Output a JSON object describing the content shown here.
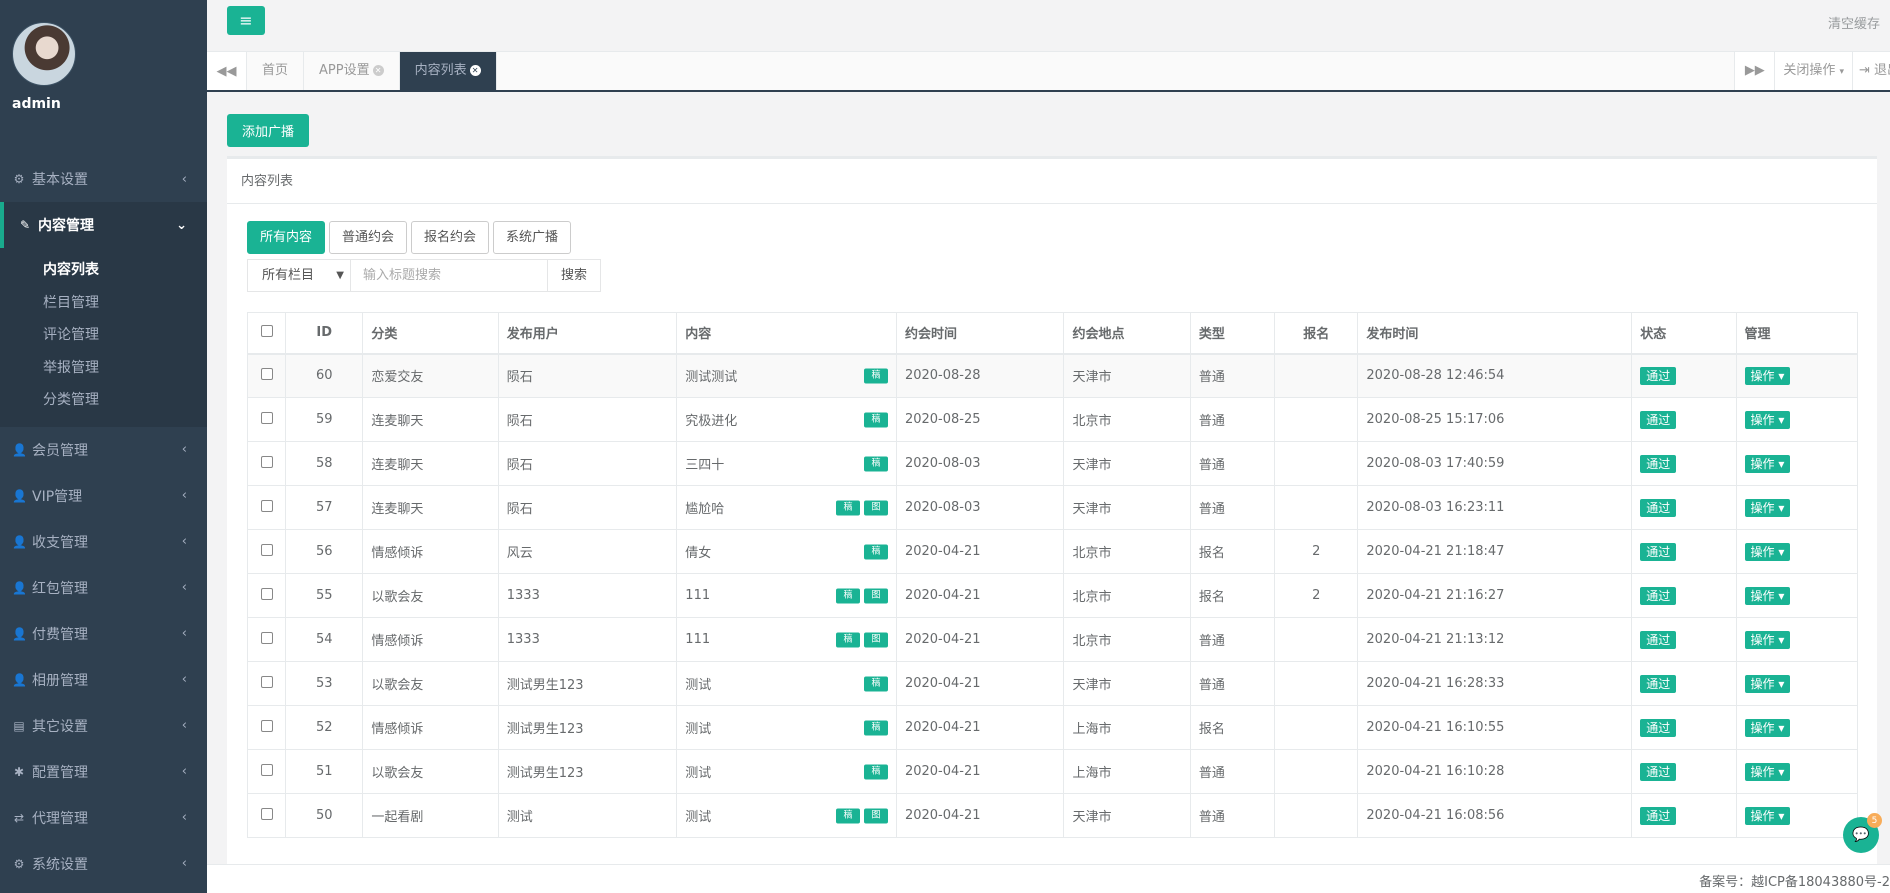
{
  "user": {
    "name": "admin"
  },
  "sidebar": {
    "items": [
      {
        "label": "基本设置",
        "icon": "gear-icon",
        "glyph": "⚙"
      },
      {
        "label": "内容管理",
        "icon": "edit-icon",
        "glyph": "✎",
        "active": true,
        "children": [
          "内容列表",
          "栏目管理",
          "评论管理",
          "举报管理",
          "分类管理"
        ]
      },
      {
        "label": "会员管理",
        "icon": "user-icon",
        "glyph": "👤"
      },
      {
        "label": "VIP管理",
        "icon": "user-icon",
        "glyph": "👤"
      },
      {
        "label": "收支管理",
        "icon": "user-icon",
        "glyph": "👤"
      },
      {
        "label": "红包管理",
        "icon": "user-icon",
        "glyph": "👤"
      },
      {
        "label": "付费管理",
        "icon": "user-icon",
        "glyph": "👤"
      },
      {
        "label": "相册管理",
        "icon": "user-icon",
        "glyph": "👤"
      },
      {
        "label": "其它设置",
        "icon": "book-icon",
        "glyph": "▤"
      },
      {
        "label": "配置管理",
        "icon": "asterisk-icon",
        "glyph": "✱"
      },
      {
        "label": "代理管理",
        "icon": "exchange-icon",
        "glyph": "⇄"
      },
      {
        "label": "系统设置",
        "icon": "gears-icon",
        "glyph": "⚙"
      }
    ]
  },
  "topbar": {
    "clear_cache": "清空缓存"
  },
  "tabs": {
    "items": [
      {
        "label": "首页",
        "closable": false
      },
      {
        "label": "APP设置",
        "closable": true
      },
      {
        "label": "内容列表",
        "closable": true,
        "active": true
      }
    ],
    "close_ops": "关闭操作",
    "logout": "退出"
  },
  "main": {
    "add_button": "添加广播",
    "panel_title": "内容列表",
    "filters": [
      "所有内容",
      "普通约会",
      "报名约会",
      "系统广播"
    ],
    "search": {
      "select_value": "所有栏目",
      "placeholder": "输入标题搜索",
      "button": "搜索"
    },
    "table": {
      "columns": [
        "ID",
        "分类",
        "发布用户",
        "内容",
        "约会时间",
        "约会地点",
        "类型",
        "报名",
        "发布时间",
        "状态",
        "管理"
      ],
      "rows": [
        {
          "id": "60",
          "cat": "恋爱交友",
          "user": "陨石",
          "content": "测试测试",
          "badges": [
            "稿"
          ],
          "date": "2020-08-28",
          "place": "天津市",
          "type": "普通",
          "signup": "",
          "time": "2020-08-28 12:46:54",
          "status": "通过",
          "op": "操作"
        },
        {
          "id": "59",
          "cat": "连麦聊天",
          "user": "陨石",
          "content": "究极进化",
          "badges": [
            "稿"
          ],
          "date": "2020-08-25",
          "place": "北京市",
          "type": "普通",
          "signup": "",
          "time": "2020-08-25 15:17:06",
          "status": "通过",
          "op": "操作"
        },
        {
          "id": "58",
          "cat": "连麦聊天",
          "user": "陨石",
          "content": "三四十",
          "badges": [
            "稿"
          ],
          "date": "2020-08-03",
          "place": "天津市",
          "type": "普通",
          "signup": "",
          "time": "2020-08-03 17:40:59",
          "status": "通过",
          "op": "操作"
        },
        {
          "id": "57",
          "cat": "连麦聊天",
          "user": "陨石",
          "content": "尴尬哈",
          "badges": [
            "稿",
            "图"
          ],
          "date": "2020-08-03",
          "place": "天津市",
          "type": "普通",
          "signup": "",
          "time": "2020-08-03 16:23:11",
          "status": "通过",
          "op": "操作"
        },
        {
          "id": "56",
          "cat": "情感倾诉",
          "user": "风云",
          "content": "倩女",
          "badges": [
            "稿"
          ],
          "date": "2020-04-21",
          "place": "北京市",
          "type": "报名",
          "signup": "2",
          "time": "2020-04-21 21:18:47",
          "status": "通过",
          "op": "操作"
        },
        {
          "id": "55",
          "cat": "以歌会友",
          "user": "1333",
          "content": "111",
          "badges": [
            "稿",
            "图"
          ],
          "date": "2020-04-21",
          "place": "北京市",
          "type": "报名",
          "signup": "2",
          "time": "2020-04-21 21:16:27",
          "status": "通过",
          "op": "操作"
        },
        {
          "id": "54",
          "cat": "情感倾诉",
          "user": "1333",
          "content": "111",
          "badges": [
            "稿",
            "图"
          ],
          "date": "2020-04-21",
          "place": "北京市",
          "type": "普通",
          "signup": "",
          "time": "2020-04-21 21:13:12",
          "status": "通过",
          "op": "操作"
        },
        {
          "id": "53",
          "cat": "以歌会友",
          "user": "测试男生123",
          "content": "测试",
          "badges": [
            "稿"
          ],
          "date": "2020-04-21",
          "place": "天津市",
          "type": "普通",
          "signup": "",
          "time": "2020-04-21 16:28:33",
          "status": "通过",
          "op": "操作"
        },
        {
          "id": "52",
          "cat": "情感倾诉",
          "user": "测试男生123",
          "content": "测试",
          "badges": [
            "稿"
          ],
          "date": "2020-04-21",
          "place": "上海市",
          "type": "报名",
          "signup": "",
          "time": "2020-04-21 16:10:55",
          "status": "通过",
          "op": "操作"
        },
        {
          "id": "51",
          "cat": "以歌会友",
          "user": "测试男生123",
          "content": "测试",
          "badges": [
            "稿"
          ],
          "date": "2020-04-21",
          "place": "上海市",
          "type": "普通",
          "signup": "",
          "time": "2020-04-21 16:10:28",
          "status": "通过",
          "op": "操作"
        },
        {
          "id": "50",
          "cat": "一起看剧",
          "user": "测试",
          "content": "测试",
          "badges": [
            "稿",
            "图"
          ],
          "date": "2020-04-21",
          "place": "天津市",
          "type": "普通",
          "signup": "",
          "time": "2020-04-21 16:08:56",
          "status": "通过",
          "op": "操作"
        }
      ]
    }
  },
  "footer": {
    "icp": "备案号：越ICP备18043880号-2"
  },
  "chat": {
    "count": "5"
  },
  "colors": {
    "sidebar": "#2f4050",
    "accent": "#1ab394"
  }
}
